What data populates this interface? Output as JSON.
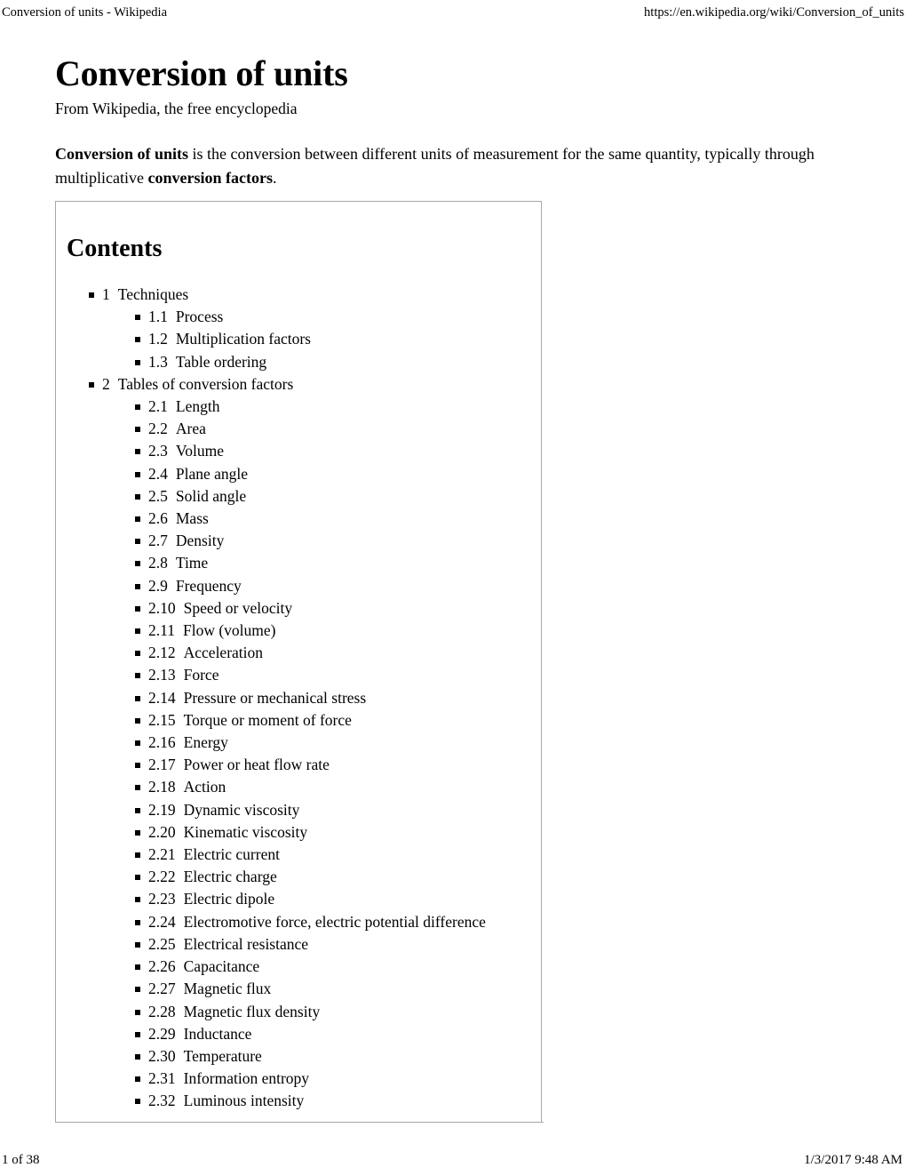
{
  "print_header": {
    "left": "Conversion of units - Wikipedia",
    "right": "https://en.wikipedia.org/wiki/Conversion_of_units"
  },
  "article": {
    "title": "Conversion of units",
    "subtitle": "From Wikipedia, the free encyclopedia",
    "intro": {
      "lead_bold": "Conversion of units",
      "text_1": " is the conversion between different units of measurement for the same quantity, typically through multiplicative ",
      "term_bold": "conversion factors",
      "text_2": "."
    }
  },
  "toc": {
    "heading": "Contents",
    "items": [
      {
        "level": 1,
        "num": "1",
        "label": "Techniques"
      },
      {
        "level": 2,
        "num": "1.1",
        "label": "Process"
      },
      {
        "level": 2,
        "num": "1.2",
        "label": "Multiplication factors"
      },
      {
        "level": 2,
        "num": "1.3",
        "label": "Table ordering"
      },
      {
        "level": 1,
        "num": "2",
        "label": "Tables of conversion factors"
      },
      {
        "level": 2,
        "num": "2.1",
        "label": "Length"
      },
      {
        "level": 2,
        "num": "2.2",
        "label": "Area"
      },
      {
        "level": 2,
        "num": "2.3",
        "label": "Volume"
      },
      {
        "level": 2,
        "num": "2.4",
        "label": "Plane angle"
      },
      {
        "level": 2,
        "num": "2.5",
        "label": "Solid angle"
      },
      {
        "level": 2,
        "num": "2.6",
        "label": "Mass"
      },
      {
        "level": 2,
        "num": "2.7",
        "label": "Density"
      },
      {
        "level": 2,
        "num": "2.8",
        "label": "Time"
      },
      {
        "level": 2,
        "num": "2.9",
        "label": "Frequency"
      },
      {
        "level": 2,
        "num": "2.10",
        "label": "Speed or velocity"
      },
      {
        "level": 2,
        "num": "2.11",
        "label": "Flow (volume)"
      },
      {
        "level": 2,
        "num": "2.12",
        "label": "Acceleration"
      },
      {
        "level": 2,
        "num": "2.13",
        "label": "Force"
      },
      {
        "level": 2,
        "num": "2.14",
        "label": "Pressure or mechanical stress"
      },
      {
        "level": 2,
        "num": "2.15",
        "label": "Torque or moment of force"
      },
      {
        "level": 2,
        "num": "2.16",
        "label": "Energy"
      },
      {
        "level": 2,
        "num": "2.17",
        "label": "Power or heat flow rate"
      },
      {
        "level": 2,
        "num": "2.18",
        "label": "Action"
      },
      {
        "level": 2,
        "num": "2.19",
        "label": "Dynamic viscosity"
      },
      {
        "level": 2,
        "num": "2.20",
        "label": "Kinematic viscosity"
      },
      {
        "level": 2,
        "num": "2.21",
        "label": "Electric current"
      },
      {
        "level": 2,
        "num": "2.22",
        "label": "Electric charge"
      },
      {
        "level": 2,
        "num": "2.23",
        "label": "Electric dipole"
      },
      {
        "level": 2,
        "num": "2.24",
        "label": "Electromotive force, electric potential difference"
      },
      {
        "level": 2,
        "num": "2.25",
        "label": "Electrical resistance"
      },
      {
        "level": 2,
        "num": "2.26",
        "label": "Capacitance"
      },
      {
        "level": 2,
        "num": "2.27",
        "label": "Magnetic flux"
      },
      {
        "level": 2,
        "num": "2.28",
        "label": "Magnetic flux density"
      },
      {
        "level": 2,
        "num": "2.29",
        "label": "Inductance"
      },
      {
        "level": 2,
        "num": "2.30",
        "label": "Temperature"
      },
      {
        "level": 2,
        "num": "2.31",
        "label": "Information entropy"
      },
      {
        "level": 2,
        "num": "2.32",
        "label": "Luminous intensity"
      }
    ]
  },
  "print_footer": {
    "left": "1 of 38",
    "right": "1/3/2017 9:48 AM"
  }
}
